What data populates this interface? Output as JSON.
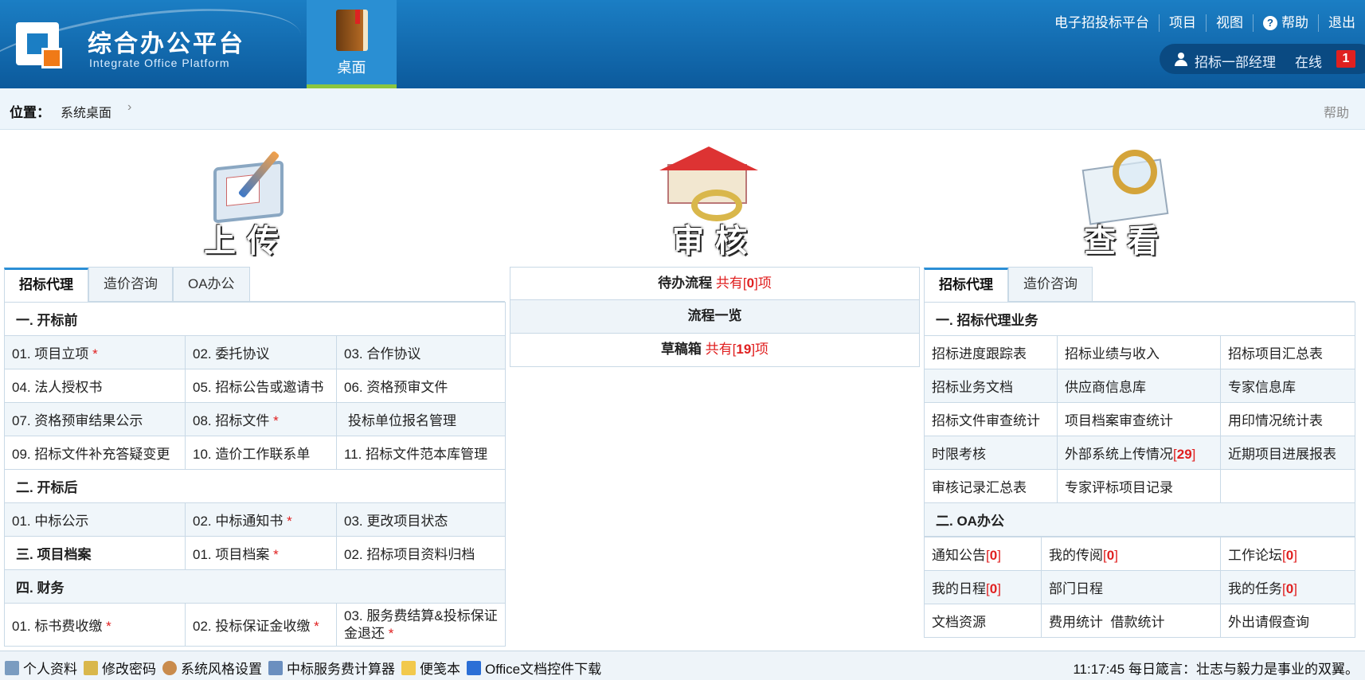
{
  "header": {
    "logo_title": "综合办公平台",
    "logo_subtitle": "Integrate Office Platform",
    "desk_tab": "桌面",
    "top_links": [
      "电子招投标平台",
      "项目",
      "视图",
      "帮助",
      "退出"
    ],
    "user_name": "招标一部经理",
    "online_label": "在线",
    "online_count": "1"
  },
  "breadcrumb": {
    "label": "位置：",
    "item": "系统桌面",
    "arrow": "›",
    "help": "帮助"
  },
  "hero": {
    "upload": "上传",
    "review": "审核",
    "view": "查看"
  },
  "left_panel": {
    "tabs": [
      "招标代理",
      "造价咨询",
      "OA办公"
    ],
    "sec1": "一. 开标前",
    "sec2": "二. 开标后",
    "sec3": "三. 项目档案",
    "sec4": "四. 财务",
    "items": {
      "r1c1": "01. 项目立项",
      "r1c2": "02. 委托协议",
      "r1c3": "03. 合作协议",
      "r2c1": "04. 法人授权书",
      "r2c2": "05. 招标公告或邀请书",
      "r2c3": "06. 资格预审文件",
      "r3c1": "07. 资格预审结果公示",
      "r3c2": "08. 招标文件",
      "r3c3": "投标单位报名管理",
      "r4c1": "09. 招标文件补充答疑变更",
      "r4c2": "10. 造价工作联系单",
      "r4c3": "11. 招标文件范本库管理",
      "r5c1": "01. 中标公示",
      "r5c2": "02. 中标通知书",
      "r5c3": "03. 更改项目状态",
      "r6c2": "01. 项目档案",
      "r6c3": "02. 招标项目资料归档",
      "r7c1": "01. 标书费收缴",
      "r7c2": "02. 投标保证金收缴",
      "r7c3": "03. 服务费结算&投标保证金退还"
    },
    "required_mark": "*"
  },
  "mid_panel": {
    "pending_label": "待办流程",
    "pending_prefix": "共有[",
    "pending_count": "0",
    "pending_suffix": "]项",
    "overview_label": "流程一览",
    "draft_label": "草稿箱",
    "draft_prefix": "共有[",
    "draft_count": "19",
    "draft_suffix": "]项"
  },
  "right_panel": {
    "tabs": [
      "招标代理",
      "造价咨询"
    ],
    "sec1": "一. 招标代理业务",
    "sec2": "二. OA办公",
    "biz": {
      "r1c1": "招标进度跟踪表",
      "r1c2": "招标业绩与收入",
      "r1c3": "招标项目汇总表",
      "r2c1": "招标业务文档",
      "r2c2": "供应商信息库",
      "r2c3": "专家信息库",
      "r3c1": "招标文件审查统计",
      "r3c2": "项目档案审查统计",
      "r3c3": "用印情况统计表",
      "r4c1": "时限考核",
      "r4c2": "外部系统上传情况",
      "r4c2_count": "29",
      "r4c3": "近期项目进展报表",
      "r5c1": "审核记录汇总表",
      "r5c2": "专家评标项目记录"
    },
    "oa": {
      "notice": "通知公告",
      "notice_count": "0",
      "circulate": "我的传阅",
      "circulate_count": "0",
      "forum": "工作论坛",
      "forum_count": "0",
      "schedule": "我的日程",
      "schedule_count": "0",
      "dept_schedule": "部门日程",
      "tasks": "我的任务",
      "tasks_count": "0",
      "docs": "文档资源",
      "expense": "费用统计",
      "loan": "借款统计",
      "leave": "外出请假查询"
    },
    "lb": "[",
    "rb": "]"
  },
  "footer": {
    "links": [
      "个人资料",
      "修改密码",
      "系统风格设置",
      "中标服务费计算器",
      "便笺本",
      "Office文档控件下载"
    ],
    "clock": "11:17:45",
    "motto": "每日箴言：壮志与毅力是事业的双翼。"
  },
  "colors": {
    "header_top": "#1b7ec4",
    "header_bottom": "#0c5a9c",
    "accent_green": "#8bc63f",
    "accent_red": "#e02020",
    "row_alt": "#f0f6fa"
  }
}
